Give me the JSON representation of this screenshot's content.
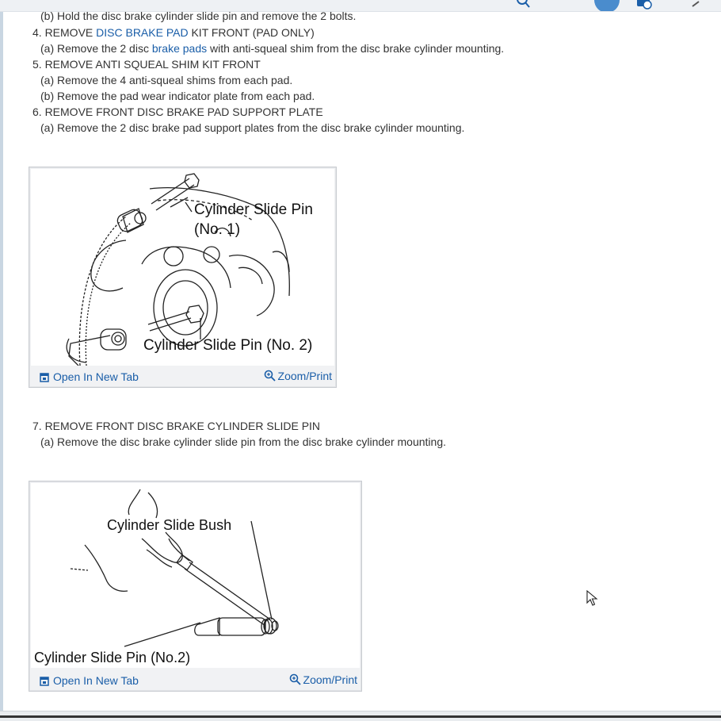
{
  "steps": {
    "step3b": "(b) Hold the disc brake cylinder slide pin and remove the 2 bolts.",
    "step4": {
      "prefix": "4. REMOVE ",
      "link": "DISC BRAKE PAD",
      "suffix": " KIT FRONT (PAD ONLY)"
    },
    "step4a": {
      "prefix": "(a) Remove the 2 disc ",
      "link": "brake pads",
      "suffix": " with anti-squeal shim from the disc brake cylinder mounting."
    },
    "step5": "5. REMOVE ANTI SQUEAL SHIM KIT FRONT",
    "step5a": "(a) Remove the 4 anti-squeal shims from each pad.",
    "step5b": "(b) Remove the pad wear indicator plate from each pad.",
    "step6": "6. REMOVE FRONT DISC BRAKE PAD SUPPORT PLATE",
    "step6a": "(a) Remove the 2 disc brake pad support plates from the disc brake cylinder mounting.",
    "step7": "7. REMOVE FRONT DISC BRAKE CYLINDER SLIDE PIN",
    "step7a": "(a) Remove the disc brake cylinder slide pin from the disc brake cylinder mounting."
  },
  "figure1": {
    "label_pin1_line1": "Cylinder Slide Pin",
    "label_pin1_line2": "(No. 1)",
    "label_pin2": "Cylinder Slide Pin (No. 2)",
    "open_tab": "Open In New Tab",
    "zoom": "Zoom/Print"
  },
  "figure2": {
    "label_bush": "Cylinder Slide Bush",
    "label_pin2": "Cylinder Slide Pin (No.2)",
    "open_tab": "Open In New Tab",
    "zoom": "Zoom/Print"
  },
  "icons": {
    "open_tab": "open-new-tab-icon",
    "zoom": "zoom-magnifier-icon",
    "cursor": "mouse-pointer"
  },
  "colors": {
    "link": "#1a5ea8",
    "text": "#333333",
    "figure_bg": "#f1f2f4"
  }
}
